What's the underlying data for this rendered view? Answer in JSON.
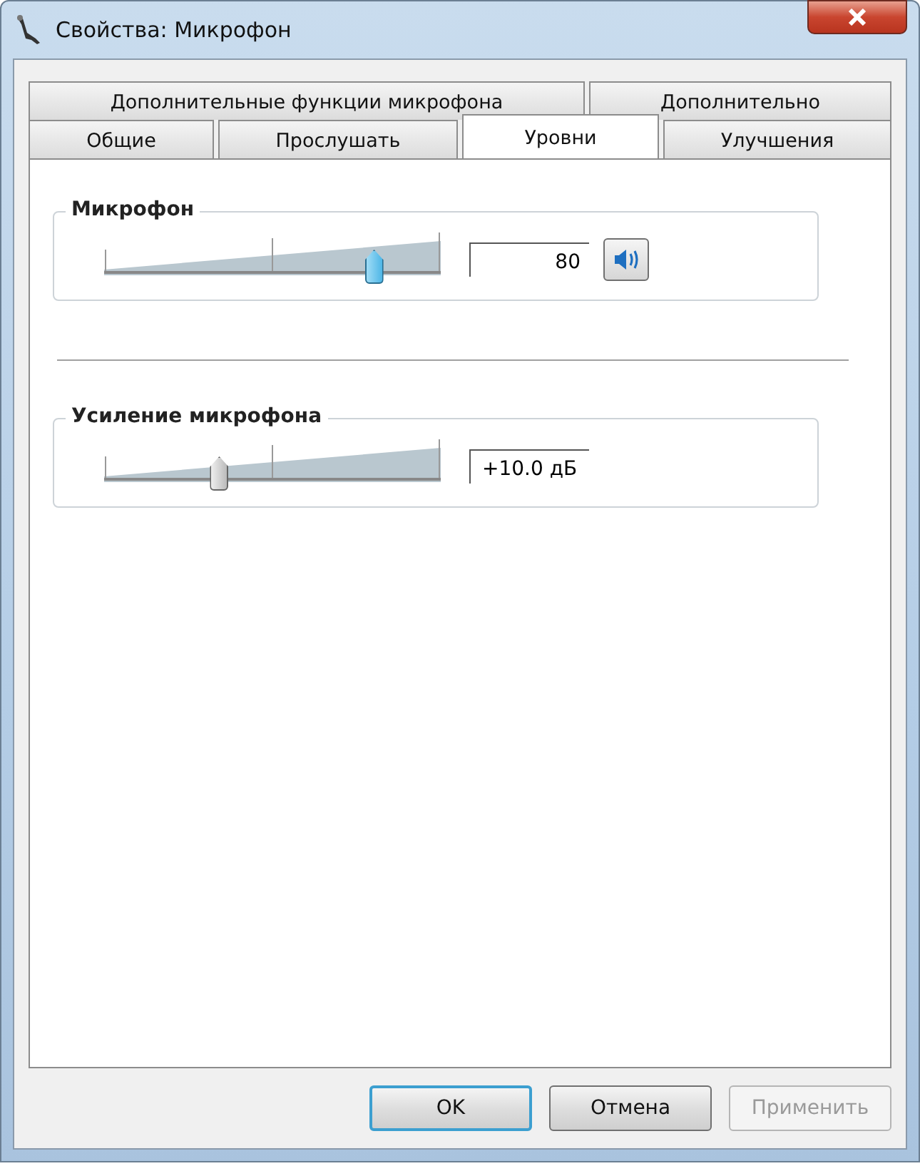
{
  "window": {
    "title": "Свойства: Микрофон"
  },
  "tab_rows": [
    {
      "tabs": [
        {
          "label": "Дополнительные функции микрофона",
          "selected": false
        },
        {
          "label": "Дополнительно",
          "selected": false
        }
      ]
    },
    {
      "tabs": [
        {
          "label": "Общие",
          "selected": false
        },
        {
          "label": "Прослушать",
          "selected": false
        },
        {
          "label": "Уровни",
          "selected": true
        },
        {
          "label": "Улучшения",
          "selected": false
        }
      ]
    }
  ],
  "groups": [
    {
      "title": "Микрофон",
      "level": 0.8,
      "value": "80",
      "focused": true,
      "mute_button": {
        "muted": false
      }
    },
    {
      "title": "Усиление микрофона",
      "level": 0.34,
      "value": "+10.0 дБ",
      "focused": false
    }
  ],
  "buttons": [
    {
      "label": "OK",
      "default": true,
      "disabled": false
    },
    {
      "label": "Отмена",
      "default": false,
      "disabled": false
    },
    {
      "label": "Применить",
      "default": false,
      "disabled": true
    }
  ]
}
